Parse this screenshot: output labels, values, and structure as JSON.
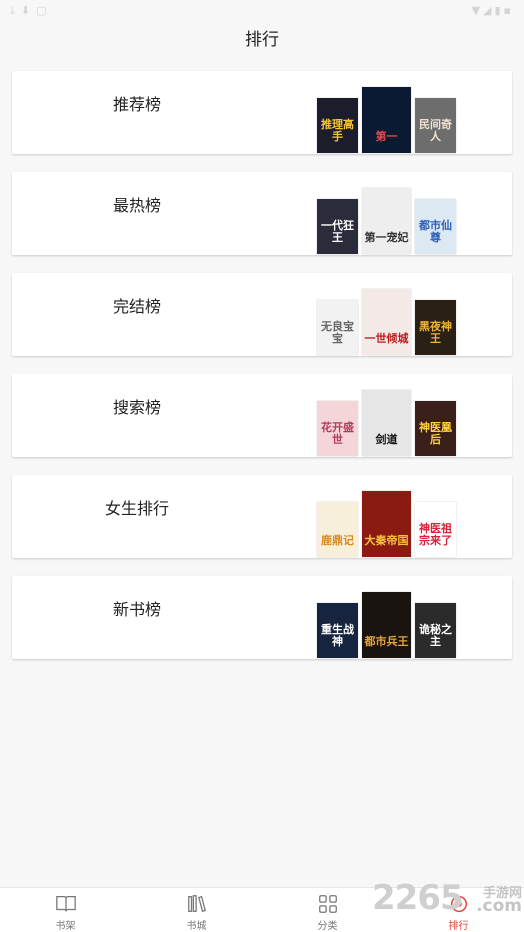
{
  "header": {
    "title": "排行"
  },
  "rankings": [
    {
      "label": "推荐榜",
      "covers": [
        {
          "title": "推理高手",
          "bg": "#1b1d2b",
          "fg": "#f4c430"
        },
        {
          "title": "第一",
          "bg": "#0b1a33",
          "fg": "#e34b4b"
        },
        {
          "title": "民间奇人",
          "bg": "#6d6d6d",
          "fg": "#f0e3d0"
        }
      ]
    },
    {
      "label": "最热榜",
      "covers": [
        {
          "title": "一代狂王",
          "bg": "#2a2c3c",
          "fg": "#ffffff"
        },
        {
          "title": "第一宠妃",
          "bg": "#eeeeee",
          "fg": "#333333"
        },
        {
          "title": "都市仙尊",
          "bg": "#dce8f2",
          "fg": "#2c5fb5"
        }
      ]
    },
    {
      "label": "完结榜",
      "covers": [
        {
          "title": "无良宝宝",
          "bg": "#f2f2f2",
          "fg": "#666666"
        },
        {
          "title": "一世倾城",
          "bg": "#f3e9e7",
          "fg": "#b81f1f"
        },
        {
          "title": "黑夜神王",
          "bg": "#2a2016",
          "fg": "#f2b233"
        }
      ]
    },
    {
      "label": "搜索榜",
      "covers": [
        {
          "title": "花开盛世",
          "bg": "#f4d6d9",
          "fg": "#b53b5a"
        },
        {
          "title": "剑道",
          "bg": "#e6e6e6",
          "fg": "#111111"
        },
        {
          "title": "神医凰后",
          "bg": "#3a1f1a",
          "fg": "#ffd23b"
        }
      ]
    },
    {
      "label": "女生排行",
      "covers": [
        {
          "title": "鹿鼎记",
          "bg": "#f7efd9",
          "fg": "#d98a1c"
        },
        {
          "title": "大秦帝国",
          "bg": "#8a1a12",
          "fg": "#f7c13d"
        },
        {
          "title": "神医祖宗来了",
          "bg": "#ffffff",
          "fg": "#d7233a"
        }
      ]
    },
    {
      "label": "新书榜",
      "covers": [
        {
          "title": "重生战神",
          "bg": "#16243f",
          "fg": "#ffffff"
        },
        {
          "title": "都市兵王",
          "bg": "#1a1410",
          "fg": "#e0a43a"
        },
        {
          "title": "诡秘之主",
          "bg": "#2b2b2b",
          "fg": "#ffffff"
        }
      ]
    }
  ],
  "tabbar": {
    "items": [
      {
        "label": "书架",
        "icon": "book-open-icon"
      },
      {
        "label": "书城",
        "icon": "bookshelf-icon"
      },
      {
        "label": "分类",
        "icon": "grid-icon"
      },
      {
        "label": "排行",
        "icon": "ranking-icon"
      }
    ],
    "active_color": "#e8453c"
  },
  "watermark": {
    "num": "2265",
    "cn": "手游网",
    "domain": ".com"
  }
}
